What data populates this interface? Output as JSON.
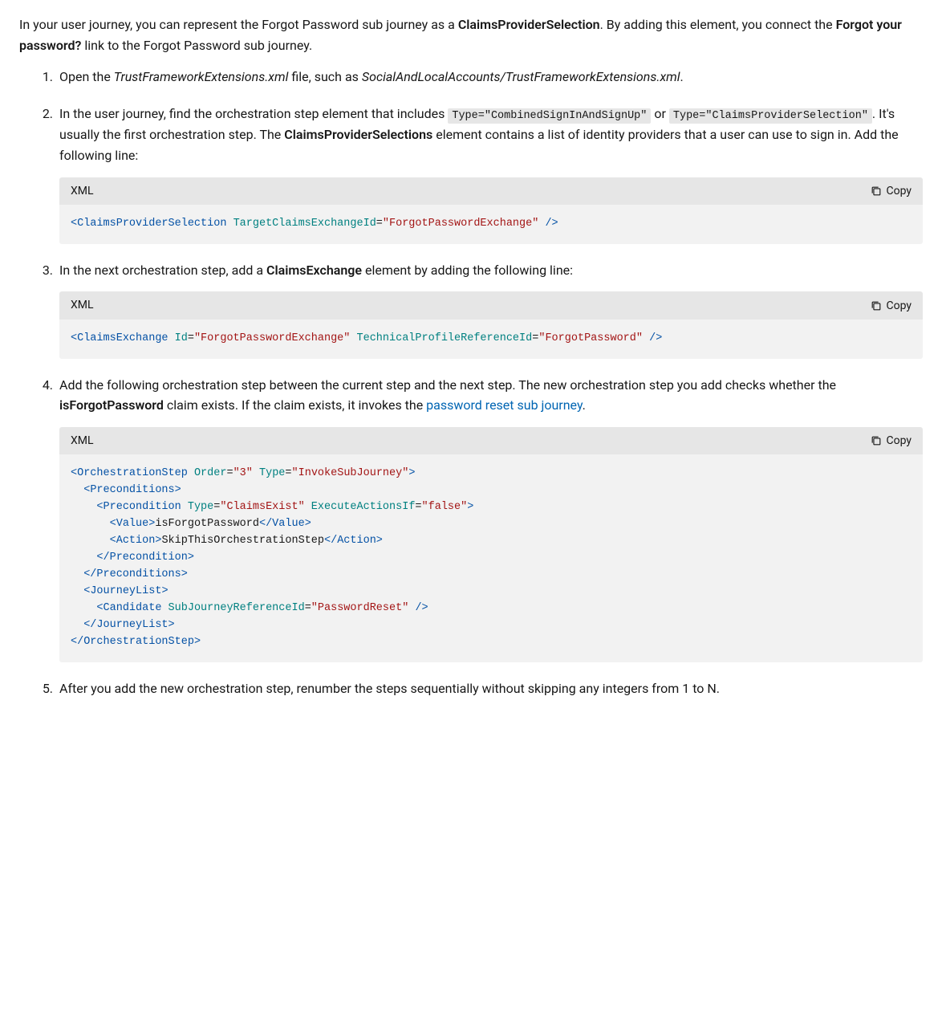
{
  "intro": {
    "p1_a": "In your user journey, you can represent the Forgot Password sub journey as a ",
    "p1_bold1": "ClaimsProviderSelection",
    "p1_b": ". By adding this element, you connect the ",
    "p1_bold2": "Forgot your password?",
    "p1_c": " link to the Forgot Password sub journey."
  },
  "steps": {
    "s1": {
      "a": "Open the ",
      "file1": "TrustFrameworkExtensions.xml",
      "b": " file, such as ",
      "file2": "SocialAndLocalAccounts/TrustFrameworkExtensions.xml",
      "c": "."
    },
    "s2": {
      "a": "In the user journey, find the orchestration step element that includes ",
      "code1": "Type=\"CombinedSignInAndSignUp\"",
      "b": " or ",
      "code2": "Type=\"ClaimsProviderSelection\"",
      "c": ". It's usually the first orchestration step. The ",
      "bold": "ClaimsProviderSelections",
      "d": " element contains a list of identity providers that a user can use to sign in. Add the following line:"
    },
    "s3": {
      "a": "In the next orchestration step, add a ",
      "bold": "ClaimsExchange",
      "b": " element by adding the following line:"
    },
    "s4": {
      "a": "Add the following orchestration step between the current step and the next step. The new orchestration step you add checks whether the ",
      "bold": "isForgotPassword",
      "b": " claim exists. If the claim exists, it invokes the ",
      "link": "password reset sub journey",
      "c": "."
    },
    "s5": {
      "a": "After you add the new orchestration step, renumber the steps sequentially without skipping any integers from 1 to N."
    }
  },
  "codebox": {
    "lang": "XML",
    "copy": "Copy"
  },
  "code1": {
    "tag": "ClaimsProviderSelection",
    "attr": "TargetClaimsExchangeId",
    "val": "\"ForgotPasswordExchange\""
  },
  "code2": {
    "tag": "ClaimsExchange",
    "attr1": "Id",
    "val1": "\"ForgotPasswordExchange\"",
    "attr2": "TechnicalProfileReferenceId",
    "val2": "\"ForgotPassword\""
  },
  "code3": {
    "l1_tag": "OrchestrationStep",
    "l1_attr1": "Order",
    "l1_val1": "\"3\"",
    "l1_attr2": "Type",
    "l1_val2": "\"InvokeSubJourney\"",
    "l2_tag": "Preconditions",
    "l3_tag": "Precondition",
    "l3_attr1": "Type",
    "l3_val1": "\"ClaimsExist\"",
    "l3_attr2": "ExecuteActionsIf",
    "l3_val2": "\"false\"",
    "l4_tag": "Value",
    "l4_txt": "isForgotPassword",
    "l5_tag": "Action",
    "l5_txt": "SkipThisOrchestrationStep",
    "l6_tag": "JourneyList",
    "l7_tag": "Candidate",
    "l7_attr": "SubJourneyReferenceId",
    "l7_val": "\"PasswordReset\""
  }
}
